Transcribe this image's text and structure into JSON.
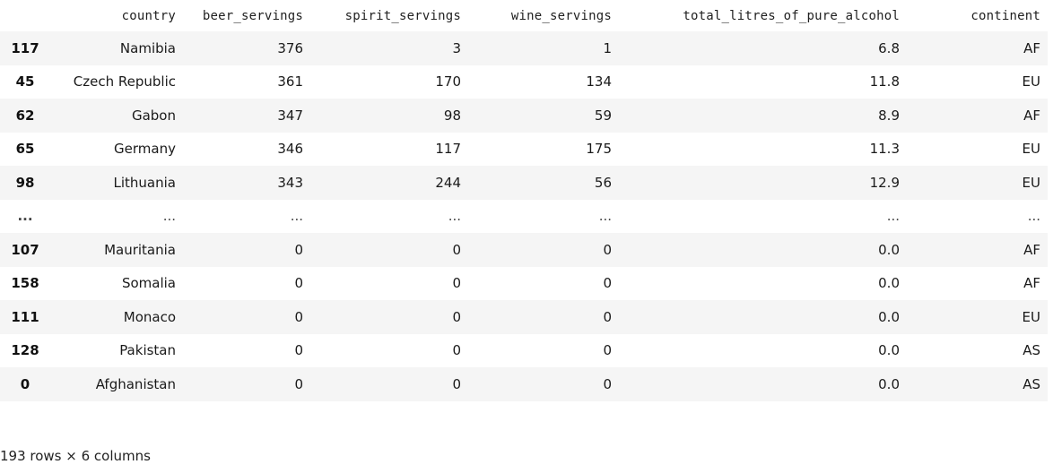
{
  "table": {
    "columns": [
      "",
      "country",
      "beer_servings",
      "spirit_servings",
      "wine_servings",
      "total_litres_of_pure_alcohol",
      "continent"
    ],
    "rows": [
      {
        "index": "117",
        "country": "Namibia",
        "beer": "376",
        "spirit": "3",
        "wine": "1",
        "total": "6.8",
        "continent": "AF"
      },
      {
        "index": "45",
        "country": "Czech Republic",
        "beer": "361",
        "spirit": "170",
        "wine": "134",
        "total": "11.8",
        "continent": "EU"
      },
      {
        "index": "62",
        "country": "Gabon",
        "beer": "347",
        "spirit": "98",
        "wine": "59",
        "total": "8.9",
        "continent": "AF"
      },
      {
        "index": "65",
        "country": "Germany",
        "beer": "346",
        "spirit": "117",
        "wine": "175",
        "total": "11.3",
        "continent": "EU"
      },
      {
        "index": "98",
        "country": "Lithuania",
        "beer": "343",
        "spirit": "244",
        "wine": "56",
        "total": "12.9",
        "continent": "EU"
      },
      {
        "index": "...",
        "country": "...",
        "beer": "...",
        "spirit": "...",
        "wine": "...",
        "total": "...",
        "continent": "..."
      },
      {
        "index": "107",
        "country": "Mauritania",
        "beer": "0",
        "spirit": "0",
        "wine": "0",
        "total": "0.0",
        "continent": "AF"
      },
      {
        "index": "158",
        "country": "Somalia",
        "beer": "0",
        "spirit": "0",
        "wine": "0",
        "total": "0.0",
        "continent": "AF"
      },
      {
        "index": "111",
        "country": "Monaco",
        "beer": "0",
        "spirit": "0",
        "wine": "0",
        "total": "0.0",
        "continent": "EU"
      },
      {
        "index": "128",
        "country": "Pakistan",
        "beer": "0",
        "spirit": "0",
        "wine": "0",
        "total": "0.0",
        "continent": "AS"
      },
      {
        "index": "0",
        "country": "Afghanistan",
        "beer": "0",
        "spirit": "0",
        "wine": "0",
        "total": "0.0",
        "continent": "AS"
      }
    ]
  },
  "shape_text": "193 rows × 6 columns",
  "colors": {
    "stripe": "#f5f5f5",
    "background": "#ffffff",
    "text": "#1a1a1a"
  }
}
